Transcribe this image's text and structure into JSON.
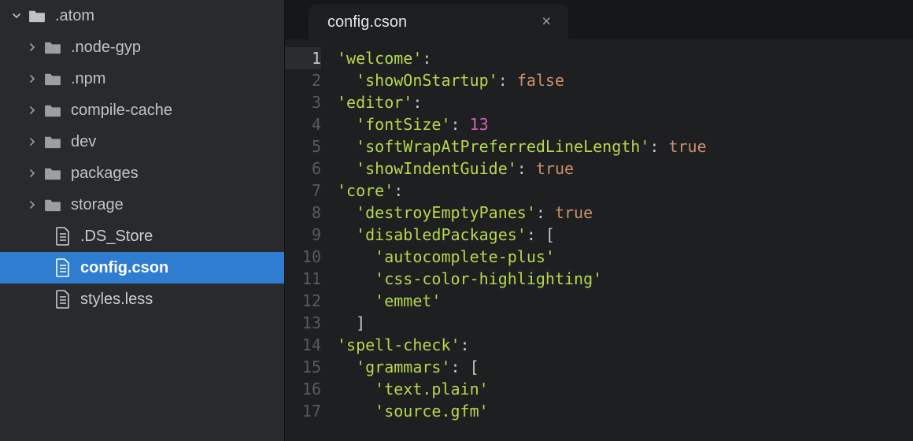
{
  "sidebar": {
    "root": {
      "name": ".atom",
      "expanded": true
    },
    "folders": [
      {
        "name": ".node-gyp"
      },
      {
        "name": ".npm"
      },
      {
        "name": "compile-cache"
      },
      {
        "name": "dev"
      },
      {
        "name": "packages"
      },
      {
        "name": "storage"
      }
    ],
    "files": [
      {
        "name": ".DS_Store",
        "selected": false
      },
      {
        "name": "config.cson",
        "selected": true
      },
      {
        "name": "styles.less",
        "selected": false
      }
    ]
  },
  "tab": {
    "title": "config.cson",
    "close_glyph": "×"
  },
  "code": {
    "active_line": 1,
    "lines": [
      [
        {
          "t": "str",
          "v": "'welcome'"
        },
        {
          "t": "punc",
          "v": ":"
        }
      ],
      [
        {
          "t": "punc",
          "v": "  "
        },
        {
          "t": "str",
          "v": "'showOnStartup'"
        },
        {
          "t": "punc",
          "v": ": "
        },
        {
          "t": "kw",
          "v": "false"
        }
      ],
      [
        {
          "t": "str",
          "v": "'editor'"
        },
        {
          "t": "punc",
          "v": ":"
        }
      ],
      [
        {
          "t": "punc",
          "v": "  "
        },
        {
          "t": "str",
          "v": "'fontSize'"
        },
        {
          "t": "punc",
          "v": ": "
        },
        {
          "t": "num",
          "v": "13"
        }
      ],
      [
        {
          "t": "punc",
          "v": "  "
        },
        {
          "t": "str",
          "v": "'softWrapAtPreferredLineLength'"
        },
        {
          "t": "punc",
          "v": ": "
        },
        {
          "t": "kw",
          "v": "true"
        }
      ],
      [
        {
          "t": "punc",
          "v": "  "
        },
        {
          "t": "str",
          "v": "'showIndentGuide'"
        },
        {
          "t": "punc",
          "v": ": "
        },
        {
          "t": "kw",
          "v": "true"
        }
      ],
      [
        {
          "t": "str",
          "v": "'core'"
        },
        {
          "t": "punc",
          "v": ":"
        }
      ],
      [
        {
          "t": "punc",
          "v": "  "
        },
        {
          "t": "str",
          "v": "'destroyEmptyPanes'"
        },
        {
          "t": "punc",
          "v": ": "
        },
        {
          "t": "kw",
          "v": "true"
        }
      ],
      [
        {
          "t": "punc",
          "v": "  "
        },
        {
          "t": "str",
          "v": "'disabledPackages'"
        },
        {
          "t": "punc",
          "v": ": ["
        }
      ],
      [
        {
          "t": "punc",
          "v": "    "
        },
        {
          "t": "str",
          "v": "'autocomplete-plus'"
        }
      ],
      [
        {
          "t": "punc",
          "v": "    "
        },
        {
          "t": "str",
          "v": "'css-color-highlighting'"
        }
      ],
      [
        {
          "t": "punc",
          "v": "    "
        },
        {
          "t": "str",
          "v": "'emmet'"
        }
      ],
      [
        {
          "t": "punc",
          "v": "  ]"
        }
      ],
      [
        {
          "t": "str",
          "v": "'spell-check'"
        },
        {
          "t": "punc",
          "v": ":"
        }
      ],
      [
        {
          "t": "punc",
          "v": "  "
        },
        {
          "t": "str",
          "v": "'grammars'"
        },
        {
          "t": "punc",
          "v": ": ["
        }
      ],
      [
        {
          "t": "punc",
          "v": "    "
        },
        {
          "t": "str",
          "v": "'text.plain'"
        }
      ],
      [
        {
          "t": "punc",
          "v": "    "
        },
        {
          "t": "str",
          "v": "'source.gfm'"
        }
      ]
    ]
  }
}
